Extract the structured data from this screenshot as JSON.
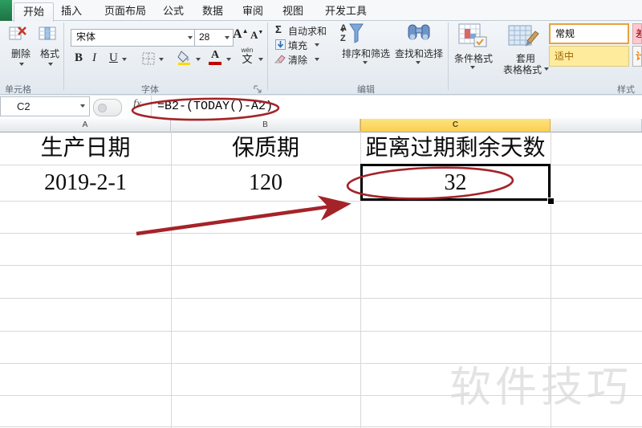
{
  "colors": {
    "annotation_red": "#a42329",
    "excel_green": "#1f7244",
    "selected_column_header_bg": "#fbd76b",
    "style_neutral_bg": "#ffeb9c",
    "style_neutral_text": "#9c6500",
    "style_bad_bg": "#ffc7ce",
    "style_bad_text": "#9c0006",
    "style_calc_text": "#fa7d00"
  },
  "tabs": [
    {
      "label": "开始",
      "active": true
    },
    {
      "label": "插入",
      "active": false
    },
    {
      "label": "页面布局",
      "active": false
    },
    {
      "label": "公式",
      "active": false
    },
    {
      "label": "数据",
      "active": false
    },
    {
      "label": "审阅",
      "active": false
    },
    {
      "label": "视图",
      "active": false
    },
    {
      "label": "开发工具",
      "active": false
    }
  ],
  "ribbon": {
    "cells_group": {
      "title": "单元格",
      "delete_label": "删除",
      "format_label": "格式"
    },
    "font_group": {
      "title": "字体",
      "font_name": "宋体",
      "font_size": "28",
      "bold_label": "B",
      "italic_label": "I",
      "underline_label": "U",
      "grow_font_label": "A",
      "shrink_font_label": "A",
      "phonetic_label": "文",
      "phonetic_pinyin": "wén"
    },
    "editing_group": {
      "title": "编辑",
      "sigma": "Σ",
      "autosum_label": "自动求和",
      "fill_label": "填充",
      "clear_label": "清除",
      "sort_filter_label": "排序和筛选",
      "find_select_label": "查找和选择"
    },
    "styles_group": {
      "title": "样式",
      "conditional_label": "条件格式",
      "format_table_line1": "套用",
      "format_table_line2": "表格格式",
      "gallery": [
        {
          "label": "常规"
        },
        {
          "label": "差"
        },
        {
          "label": "适中"
        },
        {
          "label": "计"
        }
      ]
    }
  },
  "formula_bar": {
    "name_box": "C2",
    "fx_label": "fx",
    "formula": "=B2-(TODAY()-A2)"
  },
  "sheet": {
    "column_headers": [
      "A",
      "B",
      "C"
    ],
    "selected_column": "C",
    "selected_cell": "C2",
    "cells": {
      "A1": "生产日期",
      "B1": "保质期",
      "C1": "距离过期剩余天数",
      "A2": "2019-2-1",
      "B2": "120",
      "C2": "32"
    }
  },
  "watermark": "软件技巧"
}
